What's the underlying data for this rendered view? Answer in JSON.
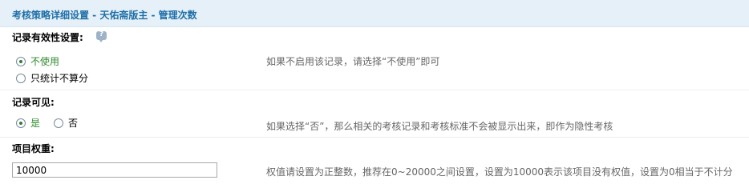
{
  "header": {
    "title": "考核策略详细设置 - 天佑斋版主 - 管理次数"
  },
  "record_validity": {
    "label": "记录有效性设置:",
    "options": [
      {
        "label": "不使用",
        "selected": true
      },
      {
        "label": "只统计不算分",
        "selected": false
      }
    ],
    "hint": "如果不启用该记录，请选择“不使用”即可"
  },
  "record_visible": {
    "label": "记录可见:",
    "options": [
      {
        "label": "是",
        "selected": true
      },
      {
        "label": "否",
        "selected": false
      }
    ],
    "hint": "如果选择“否”，那么相关的考核记录和考核标准不会被显示出来，即作为隐性考核"
  },
  "item_weight": {
    "label": "项目权重:",
    "value": "10000",
    "hint": "权值请设置为正整数，推荐在0~20000之间设置，设置为10000表示该项目没有权值，设置为0相当于不计分"
  },
  "colors": {
    "accent": "#1f6fa8",
    "selected_option": "#2e8b2e",
    "header_bg": "#e6f0f8"
  }
}
